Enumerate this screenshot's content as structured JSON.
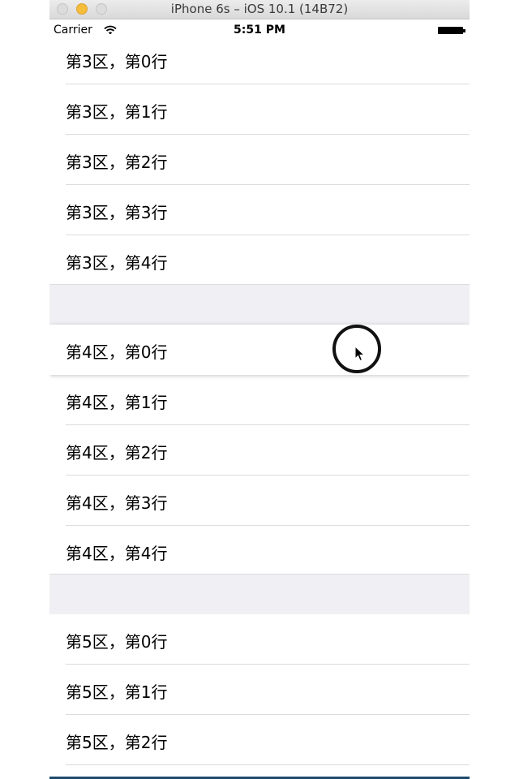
{
  "window": {
    "title": "iPhone 6s – iOS 10.1 (14B72)"
  },
  "status_bar": {
    "carrier": "Carrier",
    "time": "5:51 PM"
  },
  "sections": [
    {
      "rows": [
        "第3区，第0行",
        "第3区，第1行",
        "第3区，第2行",
        "第3区，第3行",
        "第3区，第4行"
      ]
    },
    {
      "rows": [
        "第4区，第0行",
        "第4区，第1行",
        "第4区，第2行",
        "第4区，第3行",
        "第4区，第4行"
      ]
    },
    {
      "rows": [
        "第5区，第0行",
        "第5区，第1行",
        "第5区，第2行"
      ]
    }
  ],
  "drag_state": {
    "lifted_row": "第4区，第0行"
  }
}
